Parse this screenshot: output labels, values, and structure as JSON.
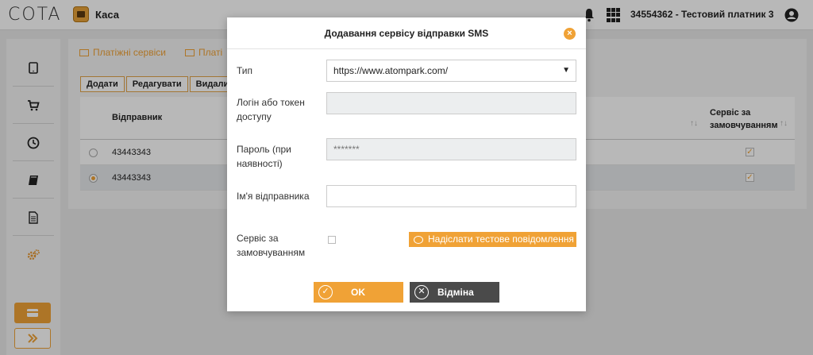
{
  "header": {
    "logo_text": "COTA",
    "app_name": "Каса",
    "account": "34554362 - Тестовий платник 3"
  },
  "icons": {
    "kasa": "cash-register-icon",
    "bell": "bell-icon",
    "apps": "apps-grid-icon",
    "user": "user-circle-icon"
  },
  "sidebar": {
    "items": [
      {
        "icon": "tablet-icon"
      },
      {
        "icon": "cart-icon"
      },
      {
        "icon": "clock-icon"
      },
      {
        "icon": "book-icon"
      },
      {
        "icon": "document-icon"
      },
      {
        "icon": "gears-icon"
      }
    ],
    "bottom_buttons": [
      {
        "icon": "card-icon"
      },
      {
        "icon": "expand-arrows-icon"
      }
    ]
  },
  "main": {
    "tabs": [
      {
        "label": "Платіжні сервіси"
      },
      {
        "label": "Платі"
      }
    ],
    "actions": {
      "add": "Додати",
      "edit": "Редагувати",
      "delete": "Видалити"
    },
    "table": {
      "col_sender": "Відправник",
      "col_default_line1": "Сервіс за",
      "col_default_line2": "замовчуванням",
      "sort_glyph": "↑↓",
      "rows": [
        {
          "sender": "43443343",
          "selected": false,
          "default": true
        },
        {
          "sender": "43443343",
          "selected": true,
          "default": true
        }
      ]
    }
  },
  "modal": {
    "title": "Додавання сервісу відправки SMS",
    "close_glyph": "×",
    "type_label": "Тип",
    "type_value": "https://www.atompark.com/",
    "login_label": "Логін або токен доступу",
    "login_value": "",
    "password_label": "Пароль (при наявності)",
    "password_value": "*******",
    "sender_label": "Ім'я відправника",
    "sender_value": "",
    "default_label": "Сервіс за замовчуванням",
    "default_checked": false,
    "test_button": "Надіслати тестове повідомлення",
    "ok_button": "OK",
    "cancel_button": "Відміна",
    "ok_glyph": "✓",
    "cancel_glyph": "✕"
  },
  "colors": {
    "accent": "#f0a236",
    "dark_button": "#4a4a4a",
    "overlay": "rgba(0,0,0,0.28)"
  }
}
